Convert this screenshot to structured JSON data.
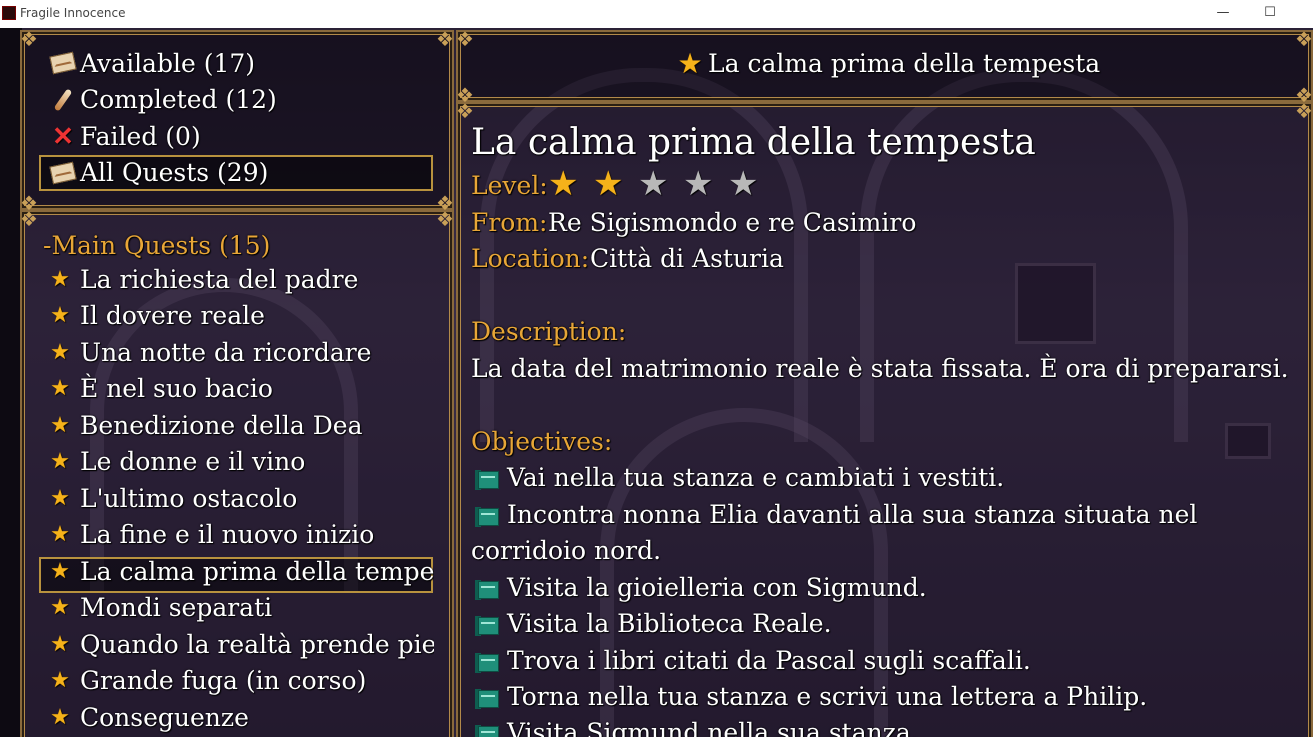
{
  "window": {
    "title": "Fragile Innocence",
    "minimize_glyph": "—",
    "maximize_glyph": "☐"
  },
  "colors": {
    "gold_label": "#e8a637",
    "frame": "#b38a4a",
    "star_filled": "#f5b21a",
    "star_empty": "#b8b8b8"
  },
  "categories": [
    {
      "icon": "envelope-icon",
      "label": "Available (17)"
    },
    {
      "icon": "quill-icon",
      "label": "Completed (12)"
    },
    {
      "icon": "red-x-icon",
      "label": "Failed (0)"
    },
    {
      "icon": "envelope-icon",
      "label": "All Quests (29)",
      "selected": true
    }
  ],
  "quest_list": {
    "group_label": "-Main Quests (15)",
    "items": [
      "La richiesta del padre",
      "Il dovere reale",
      "Una notte da ricordare",
      "È nel suo bacio",
      "Benedizione della Dea",
      "Le donne e il vino",
      "L'ultimo ostacolo",
      "La fine e il nuovo inizio",
      "La calma prima della tempesta",
      "Mondi separati",
      "Quando la realtà prende piede",
      "Grande fuga (in corso)",
      "Conseguenze"
    ],
    "selected_index": 8
  },
  "detail": {
    "header_title": "La calma prima della tempesta",
    "title": "La calma prima della tempesta",
    "level_label": "Level:",
    "level": {
      "value": 2,
      "max": 5
    },
    "from_label": "From:",
    "from_value": "Re Sigismondo e re Casimiro",
    "location_label": "Location:",
    "location_value": "Città di Asturia",
    "description_label": "Description:",
    "description": "La data del matrimonio reale è stata fissata. È ora di prepararsi.",
    "objectives_label": "Objectives:",
    "objectives": [
      "Vai nella tua stanza e cambiati i vestiti.",
      "Incontra nonna Elia davanti alla sua stanza situata nel",
      "corridoio nord.",
      "Visita la gioielleria con Sigmund.",
      "Visita la Biblioteca Reale.",
      "Trova i libri citati da Pascal sugli scaffali.",
      "Torna nella tua stanza e scrivi una lettera a Philip.",
      "Visita Sigmund nella sua stanza."
    ]
  }
}
